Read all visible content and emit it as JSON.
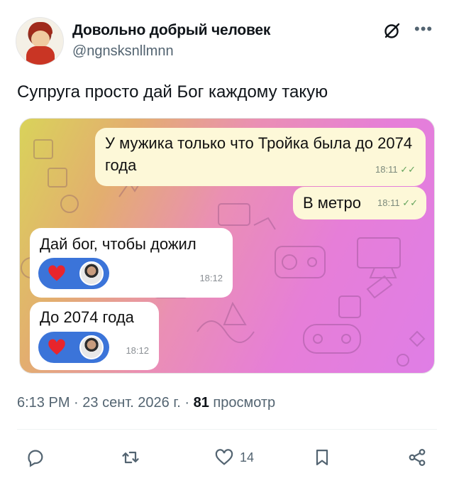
{
  "tweet": {
    "author": {
      "display_name": "Довольно добрый человек",
      "handle": "@ngnsksnllmnn"
    },
    "text": "Супруга просто дай Бог каждому такую",
    "meta": {
      "time": "6:13 PM",
      "date": "23 сент. 2026 г.",
      "views_count": "81",
      "views_label": "просмотр",
      "separator": "·"
    },
    "actions": {
      "likes_count": "14"
    }
  },
  "chat": {
    "messages": [
      {
        "direction": "outgoing",
        "text": "У мужика только что Тройка была до 2074 года",
        "time": "18:11",
        "status": "✓✓"
      },
      {
        "direction": "outgoing",
        "text": "В метро",
        "time": "18:11",
        "status": "✓✓"
      },
      {
        "direction": "incoming",
        "text": "Дай бог, чтобы дожил",
        "time": "18:12",
        "reaction": "heart"
      },
      {
        "direction": "incoming",
        "text": "До 2074 года",
        "time": "18:12",
        "reaction": "heart"
      }
    ]
  },
  "colors": {
    "outgoing_bubble": "#fdf8d8",
    "incoming_bubble": "#ffffff",
    "reaction_pill": "#3b74d9",
    "heart": "#e8252c",
    "muted_text": "#536471"
  },
  "icons": {
    "header": [
      "grok-icon",
      "more-icon"
    ],
    "actions": [
      "reply-icon",
      "retweet-icon",
      "like-icon",
      "bookmark-icon",
      "share-icon"
    ]
  }
}
